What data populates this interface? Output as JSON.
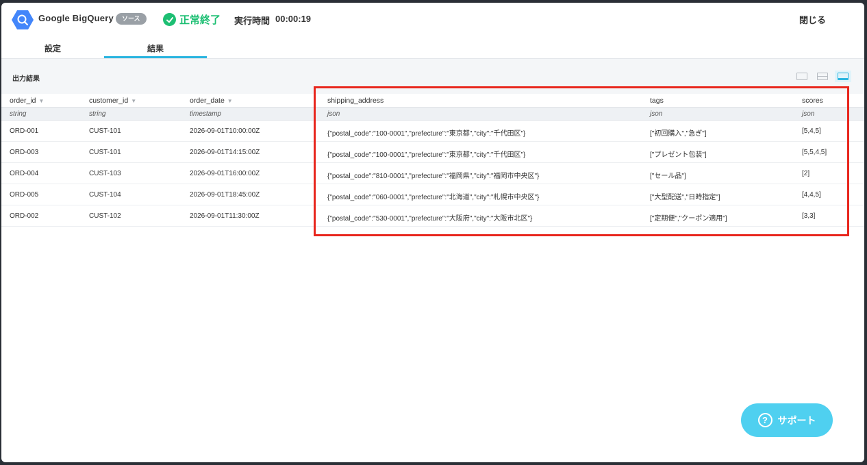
{
  "header": {
    "app_name": "Google BigQuery",
    "badge": "ソース",
    "status": "正常終了",
    "exec_label": "実行時間",
    "exec_time": "00:00:19",
    "close_label": "閉じる",
    "logo_icon": "bigquery-icon",
    "status_icon": "check-circle-icon",
    "status_color": "#1dbf73"
  },
  "tabs": [
    {
      "label": "設定",
      "active": false
    },
    {
      "label": "結果",
      "active": true
    }
  ],
  "panel": {
    "title": "出力結果",
    "view_modes": [
      "single-view-icon",
      "split-view-icon",
      "table-view-icon"
    ],
    "active_view": "table-view-icon"
  },
  "table": {
    "columns": [
      {
        "name": "order_id",
        "type": "string",
        "sortable": true
      },
      {
        "name": "customer_id",
        "type": "string",
        "sortable": true
      },
      {
        "name": "order_date",
        "type": "timestamp",
        "sortable": true
      },
      {
        "name": "shipping_address",
        "type": "json",
        "sortable": false
      },
      {
        "name": "tags",
        "type": "json",
        "sortable": false
      },
      {
        "name": "scores",
        "type": "json",
        "sortable": false
      }
    ],
    "rows": [
      [
        "ORD-001",
        "CUST-101",
        "2026-09-01T10:00:00Z",
        "{\"postal_code\":\"100-0001\",\"prefecture\":\"東京都\",\"city\":\"千代田区\"}",
        "[\"初回購入\",\"急ぎ\"]",
        "[5,4,5]"
      ],
      [
        "ORD-003",
        "CUST-101",
        "2026-09-01T14:15:00Z",
        "{\"postal_code\":\"100-0001\",\"prefecture\":\"東京都\",\"city\":\"千代田区\"}",
        "[\"プレゼント包装\"]",
        "[5,5,4,5]"
      ],
      [
        "ORD-004",
        "CUST-103",
        "2026-09-01T16:00:00Z",
        "{\"postal_code\":\"810-0001\",\"prefecture\":\"福岡県\",\"city\":\"福岡市中央区\"}",
        "[\"セール品\"]",
        "[2]"
      ],
      [
        "ORD-005",
        "CUST-104",
        "2026-09-01T18:45:00Z",
        "{\"postal_code\":\"060-0001\",\"prefecture\":\"北海道\",\"city\":\"札幌市中央区\"}",
        "[\"大型配送\",\"日時指定\"]",
        "[4,4,5]"
      ],
      [
        "ORD-002",
        "CUST-102",
        "2026-09-01T11:30:00Z",
        "{\"postal_code\":\"530-0001\",\"prefecture\":\"大阪府\",\"city\":\"大阪市北区\"}",
        "[\"定期便\",\"クーポン適用\"]",
        "[3,3]"
      ]
    ]
  },
  "support": {
    "label": "サポート",
    "icon": "help-circle-icon",
    "color": "#4fd0f0"
  },
  "highlight_color": "#e8261d"
}
